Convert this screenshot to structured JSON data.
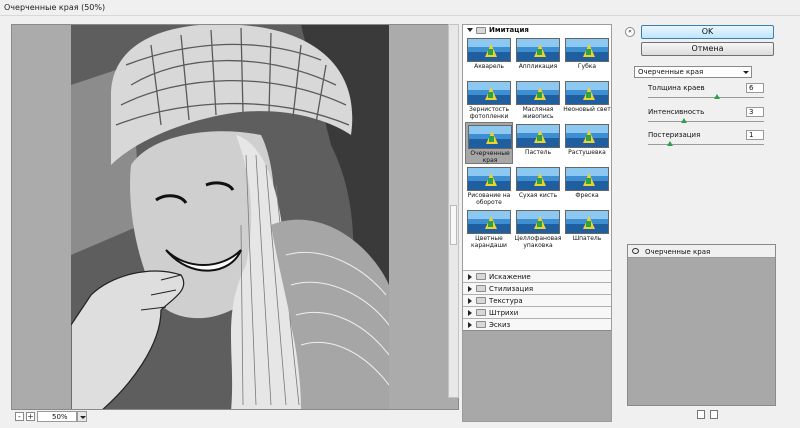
{
  "window": {
    "title": "Очерченные края (50%)"
  },
  "preview": {
    "zoom_value": "50%",
    "zoom_minus": "-",
    "zoom_plus": "+"
  },
  "gallery": {
    "open_category": "Имитация",
    "thumbnails": [
      {
        "label": "Акварель"
      },
      {
        "label": "Аппликация"
      },
      {
        "label": "Губка"
      },
      {
        "label": "Зернистость фотопленки"
      },
      {
        "label": "Масляная живопись"
      },
      {
        "label": "Неоновый свет"
      },
      {
        "label": "Очерченные края",
        "selected": true
      },
      {
        "label": "Пастель"
      },
      {
        "label": "Растушевка"
      },
      {
        "label": "Рисование на обороте"
      },
      {
        "label": "Сухая кисть"
      },
      {
        "label": "Фреска"
      },
      {
        "label": "Цветные карандаши"
      },
      {
        "label": "Целлофановая упаковка"
      },
      {
        "label": "Шпатель"
      }
    ],
    "categories": [
      "Искажение",
      "Стилизация",
      "Текстура",
      "Штрихи",
      "Эскиз"
    ]
  },
  "controls": {
    "ok_label": "OK",
    "cancel_label": "Отмена",
    "collapse_glyph": "«",
    "filter_select": "Очерченные края",
    "params": [
      {
        "label": "Толщина краев",
        "value": "6",
        "level": 0.6
      },
      {
        "label": "Интенсивность",
        "value": "3",
        "level": 0.3
      },
      {
        "label": "Постеризация",
        "value": "1",
        "level": 0.17
      }
    ]
  },
  "layers": {
    "items": [
      {
        "label": "Очерченные края"
      }
    ]
  }
}
